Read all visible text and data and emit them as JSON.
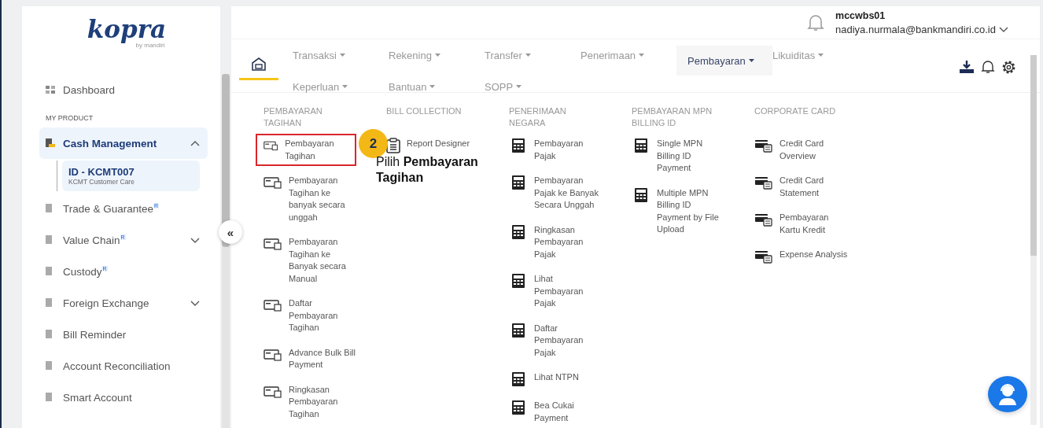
{
  "sidebar": {
    "logo": "kopra",
    "logo_sub": "by mandiri",
    "dashboard": "Dashboard",
    "section": "MY PRODUCT",
    "items": [
      {
        "label": "Cash Management",
        "expanded": true,
        "selected": true,
        "children": [
          {
            "title": "ID - KCMT007",
            "subtitle": "KCMT Customer Care",
            "selected": true
          }
        ]
      },
      {
        "label": "Trade & Guarantee",
        "badge": "R",
        "selected": false
      },
      {
        "label": "Value Chain",
        "badge": "R",
        "expanded": false,
        "selected": false
      },
      {
        "label": "Custody",
        "badge": "R",
        "selected": false
      },
      {
        "label": "Foreign Exchange",
        "expanded": false,
        "selected": false
      },
      {
        "label": "Bill Reminder",
        "selected": false
      },
      {
        "label": "Account Reconciliation",
        "selected": false
      },
      {
        "label": "Smart Account",
        "selected": false
      }
    ],
    "collapse_button": "«"
  },
  "user": {
    "name": "mccwbs01",
    "email": "nadiya.nurmala@bankmandiri.co.id"
  },
  "nav": {
    "home_selected": true,
    "tabs": [
      {
        "label": "Transaksi",
        "open": false
      },
      {
        "label": "Rekening",
        "open": false
      },
      {
        "label": "Transfer",
        "open": false
      },
      {
        "label": "Penerimaan",
        "open": false
      },
      {
        "label": "Pembayaran",
        "open": true
      },
      {
        "label": "Likuiditas",
        "open": false
      },
      {
        "label": "Keperluan",
        "open": false
      },
      {
        "label": "Bantuan",
        "open": false
      },
      {
        "label": "SOPP",
        "open": false
      }
    ]
  },
  "menu": {
    "columns": [
      {
        "title": "PEMBAYARAN TAGIHAN",
        "kind": "bill",
        "items": [
          {
            "label": "Pembayaran Tagihan",
            "highlighted": true
          },
          {
            "label": "Pembayaran Tagihan ke banyak secara unggah",
            "highlighted": false
          },
          {
            "label": "Pembayaran Tagihan ke Banyak secara Manual",
            "highlighted": false
          },
          {
            "label": "Daftar Pembayaran Tagihan",
            "highlighted": false
          },
          {
            "label": "Advance Bulk Bill Payment",
            "highlighted": false
          },
          {
            "label": "Ringkasan Pembayaran Tagihan",
            "highlighted": false
          }
        ]
      },
      {
        "title": "BILL COLLECTION",
        "kind": "clipboard",
        "items": [
          {
            "label": "Report Designer",
            "highlighted": false
          }
        ]
      },
      {
        "title": "PENERIMAAN NEGARA",
        "kind": "calculator",
        "items": [
          {
            "label": "Pembayaran Pajak",
            "highlighted": false
          },
          {
            "label": "Pembayaran Pajak ke Banyak Secara Unggah",
            "highlighted": false
          },
          {
            "label": "Ringkasan Pembayaran Pajak",
            "highlighted": false
          },
          {
            "label": "Lihat Pembayaran Pajak",
            "highlighted": false
          },
          {
            "label": "Daftar Pembayaran Pajak",
            "highlighted": false
          },
          {
            "label": "Lihat NTPN",
            "highlighted": false
          },
          {
            "label": "Bea Cukai Payment",
            "highlighted": false
          }
        ]
      },
      {
        "title": "PEMBAYARAN MPN BILLING ID",
        "kind": "calculator",
        "items": [
          {
            "label": "Single MPN Billing ID Payment",
            "highlighted": false
          },
          {
            "label": "Multiple MPN Billing ID Payment by File Upload",
            "highlighted": false
          }
        ]
      },
      {
        "title": "CORPORATE CARD",
        "kind": "cards",
        "items": [
          {
            "label": "Credit Card Overview",
            "highlighted": false
          },
          {
            "label": "Credit Card Statement",
            "highlighted": false
          },
          {
            "label": "Pembayaran Kartu Kredit",
            "highlighted": false
          },
          {
            "label": "Expense Analysis",
            "highlighted": false
          }
        ]
      }
    ]
  },
  "callout": {
    "step": "2",
    "text": "Pilih **Pembayaran Tagihan**"
  }
}
